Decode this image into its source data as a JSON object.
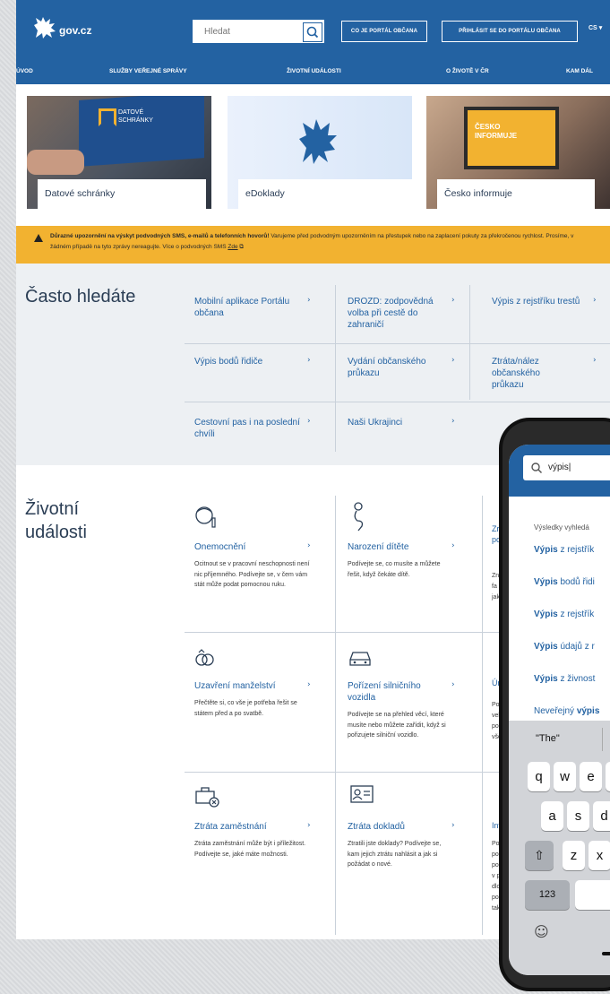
{
  "header": {
    "logo_text": "gov.cz",
    "search_placeholder": "Hledat",
    "btn_about": "CO JE PORTÁL OBČANA",
    "btn_login": "PŘIHLÁSIT SE DO PORTÁLU OBČANA",
    "lang": "CS"
  },
  "nav": [
    "ÚVOD",
    "SLUŽBY VEŘEJNÉ SPRÁVY",
    "ŽIVOTNÍ UDÁLOSTI",
    "O ŽIVOTĚ V ČR",
    "KAM DÁL"
  ],
  "tiles": [
    {
      "caption": "Datové schránky",
      "label1": "DATOVÉ",
      "label2": "SCHRÁNKY"
    },
    {
      "caption": "eDoklady"
    },
    {
      "caption": "Česko informuje",
      "label1": "ČESKO",
      "label2": "INFORMUJE"
    }
  ],
  "warning": {
    "bold": "Důrazné upozornění na výskyt podvodných SMS, e-mailů a telefonních hovorů!",
    "text": " Varujeme před podvodným upozorněním na přestupek nebo na zaplacení pokuty za překročenou rychlost. Prosíme, v žádném případě na tyto zprávy nereagujte. Více o podvodných SMS ",
    "link": "Zde"
  },
  "often": {
    "title": "Často hledáte",
    "links": [
      "Mobilní aplikace Portálu občana",
      "DROZD: zodpovědná volba při cestě do zahraničí",
      "Výpis z rejstříku trestů",
      "Výpis bodů řidiče",
      "Vydání občanského průkazu",
      "Ztráta/nález občanského průkazu",
      "Cestovní pas i na poslední chvíli",
      "Naši Ukrajinci"
    ]
  },
  "life": {
    "title": "Životní události",
    "items": [
      {
        "title": "Onemocnění",
        "desc": "Ocitnout se v pracovní neschopnosti není nic příjemného. Podívejte se, v čem vám stát může podat pomocnou ruku."
      },
      {
        "title": "Narození dítěte",
        "desc": "Podívejte se, co musíte a můžete řešit, když čekáte dítě."
      },
      {
        "title": "Uzavření manželství",
        "desc": "Přečtěte si, co vše je potřeba řešit se státem před a po svatbě."
      },
      {
        "title": "Pořízení silničního vozidla",
        "desc": "Podívejte se na přehled věcí, které musíte nebo můžete zařídit, když si pořizujete silniční vozidlo."
      },
      {
        "title": "Ztráta zaměstnání",
        "desc": "Ztráta zaměstnání může být i příležitost. Podívejte se, jaké máte možnosti."
      },
      {
        "title": "Ztráta dokladů",
        "desc": "Ztratili jste doklady? Podívejte se, kam jejich ztrátu nahlásit a jak si požádat o nové."
      }
    ],
    "partial": [
      "Zr",
      "po",
      "Zn",
      "fa",
      "jak",
      "Ún",
      "Po",
      "vel",
      "po",
      "vše",
      "Inv",
      "Po",
      "po",
      "po",
      "v p",
      "dlo",
      "po",
      "tak"
    ]
  },
  "phone": {
    "search_value": "výpis|",
    "results_title": "Výsledky vyhledá",
    "results": [
      {
        "bold": "Výpis",
        "rest": " z rejstřík"
      },
      {
        "bold": "Výpis",
        "rest": " bodů řidi"
      },
      {
        "bold": "Výpis",
        "rest": " z rejstřík"
      },
      {
        "bold": "Výpis",
        "rest": " údajů z r"
      },
      {
        "bold": "Výpis",
        "rest": " z živnost"
      },
      {
        "pre": "Neveřejný ",
        "bold": "výpis",
        "rest": ""
      }
    ],
    "suggestion": "\"The\"",
    "row1": [
      "q",
      "w",
      "e"
    ],
    "row2": [
      "a",
      "s",
      "d"
    ],
    "row3": [
      "z",
      "x"
    ],
    "numkey": "123"
  },
  "colors": {
    "primary": "#2362a2",
    "warning": "#f2b230",
    "section_bg": "#edf0f3"
  }
}
